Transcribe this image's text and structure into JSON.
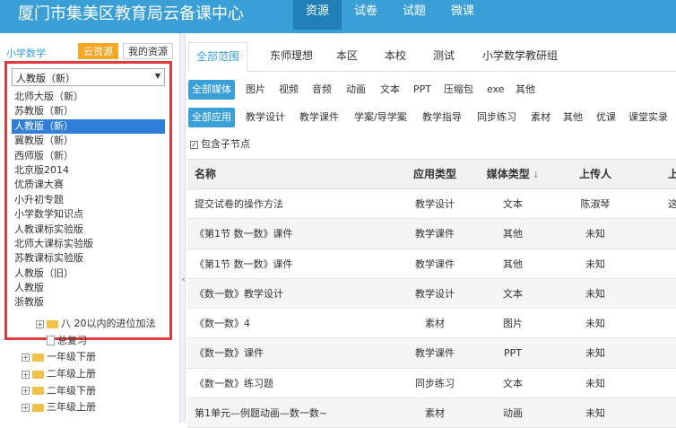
{
  "header": {
    "title": "厦门市集美区教育局云备课中心",
    "nav": [
      {
        "label": "资源",
        "active": true
      },
      {
        "label": "试卷",
        "active": false
      },
      {
        "label": "试题",
        "active": false
      },
      {
        "label": "微课",
        "active": false
      }
    ]
  },
  "sidebar": {
    "subject": "小学数学",
    "tab_cloud": "云资源",
    "tab_mine": "我的资源",
    "select_value": "人教版（新）",
    "options": [
      {
        "label": "北师大版（新）",
        "selected": false
      },
      {
        "label": "苏教版（新）",
        "selected": false
      },
      {
        "label": "人教版（新）",
        "selected": true
      },
      {
        "label": "冀教版（新）",
        "selected": false
      },
      {
        "label": "西师版（新）",
        "selected": false
      },
      {
        "label": "北京版2014",
        "selected": false
      },
      {
        "label": "优质课大赛",
        "selected": false
      },
      {
        "label": "小升初专题",
        "selected": false
      },
      {
        "label": "小学数学知识点",
        "selected": false
      },
      {
        "label": "人教课标实验版",
        "selected": false
      },
      {
        "label": "北师大课标实验版",
        "selected": false
      },
      {
        "label": "苏教课标实验版",
        "selected": false
      },
      {
        "label": "人教版（旧）",
        "selected": false
      },
      {
        "label": "人教版",
        "selected": false
      },
      {
        "label": "浙教版",
        "selected": false
      }
    ],
    "tree": [
      {
        "label": "八 20以内的进位加法",
        "indent": 1,
        "type": "folder"
      },
      {
        "label": "总复习",
        "indent": 1,
        "type": "doc"
      },
      {
        "label": "一年级下册",
        "indent": 0,
        "type": "folder"
      },
      {
        "label": "二年级上册",
        "indent": 0,
        "type": "folder"
      },
      {
        "label": "二年级下册",
        "indent": 0,
        "type": "folder"
      },
      {
        "label": "三年级上册",
        "indent": 0,
        "type": "folder"
      }
    ]
  },
  "main": {
    "scope_tabs": [
      {
        "label": "全部范围",
        "active": true
      },
      {
        "label": "东师理想",
        "active": false
      },
      {
        "label": "本区",
        "active": false
      },
      {
        "label": "本校",
        "active": false
      },
      {
        "label": "测试",
        "active": false
      },
      {
        "label": "小学数学教研组",
        "active": false
      }
    ],
    "media_filters": [
      {
        "label": "全部媒体",
        "active": true
      },
      {
        "label": "图片",
        "active": false
      },
      {
        "label": "视频",
        "active": false
      },
      {
        "label": "音频",
        "active": false
      },
      {
        "label": "动画",
        "active": false
      },
      {
        "label": "文本",
        "active": false
      },
      {
        "label": "PPT",
        "active": false
      },
      {
        "label": "压缩包",
        "active": false
      },
      {
        "label": "exe",
        "active": false
      },
      {
        "label": "其他",
        "active": false
      }
    ],
    "app_filters": [
      {
        "label": "全部应用",
        "active": true
      },
      {
        "label": "教学设计",
        "active": false
      },
      {
        "label": "教学课件",
        "active": false
      },
      {
        "label": "学案/导学案",
        "active": false
      },
      {
        "label": "教学指导",
        "active": false
      },
      {
        "label": "同步练习",
        "active": false
      },
      {
        "label": "素材",
        "active": false
      },
      {
        "label": "其他",
        "active": false
      },
      {
        "label": "优课",
        "active": false
      },
      {
        "label": "课堂实录",
        "active": false
      }
    ],
    "include_children": {
      "label": "包含子节点",
      "checked": true
    },
    "table": {
      "headers": {
        "name": "名称",
        "app": "应用类型",
        "media": "媒体类型",
        "uploader": "上传人",
        "more": "上"
      },
      "rows": [
        {
          "name": "提交试卷的操作方法",
          "app": "教学设计",
          "media": "文本",
          "uploader": "陈淑琴",
          "more": "这"
        },
        {
          "name": "《第1节 数一数》课件",
          "app": "教学课件",
          "media": "其他",
          "uploader": "未知",
          "more": ""
        },
        {
          "name": "《第1节 数一数》课件",
          "app": "教学课件",
          "media": "其他",
          "uploader": "未知",
          "more": ""
        },
        {
          "name": "《数一数》教学设计",
          "app": "教学设计",
          "media": "文本",
          "uploader": "未知",
          "more": ""
        },
        {
          "name": "《数一数》4",
          "app": "素材",
          "media": "图片",
          "uploader": "未知",
          "more": ""
        },
        {
          "name": "《数一数》课件",
          "app": "教学课件",
          "media": "PPT",
          "uploader": "未知",
          "more": ""
        },
        {
          "name": "《数一数》练习题",
          "app": "同步练习",
          "media": "文本",
          "uploader": "未知",
          "more": ""
        },
        {
          "name": "第1单元—例题动画—数一数~",
          "app": "素材",
          "media": "动画",
          "uploader": "未知",
          "more": ""
        }
      ]
    }
  },
  "colors": {
    "primary": "#3a9fd6",
    "nav_active": "#1f7fb6",
    "accent_orange": "#f5a623",
    "highlight_border": "#e23b3b",
    "selected_option": "#2f7fd8"
  }
}
